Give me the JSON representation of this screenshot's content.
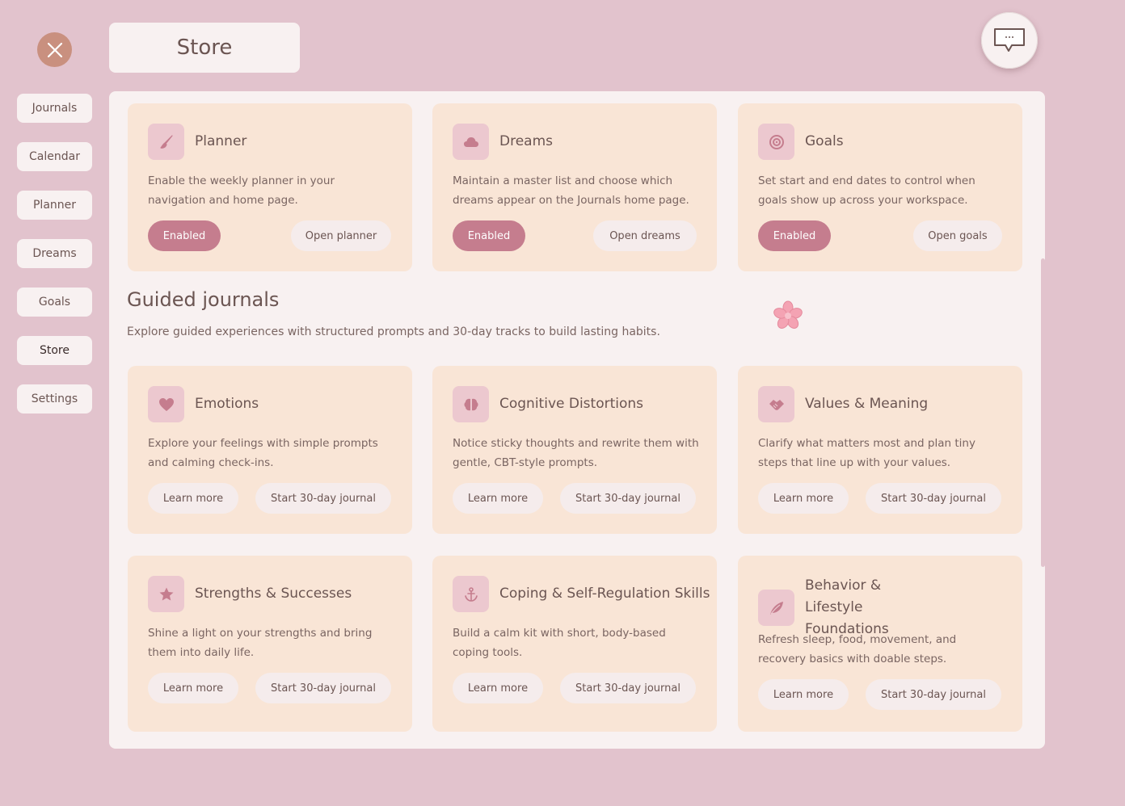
{
  "header": {
    "title": "Store"
  },
  "sidebar": {
    "items": [
      {
        "label": "Journals"
      },
      {
        "label": "Calendar"
      },
      {
        "label": "Planner"
      },
      {
        "label": "Dreams"
      },
      {
        "label": "Goals"
      },
      {
        "label": "Store",
        "active": true
      },
      {
        "label": "Settings"
      }
    ]
  },
  "features": [
    {
      "title": "Planner",
      "icon": "brush-icon",
      "desc": "Enable the weekly planner in your navigation and home page.",
      "status": "Enabled",
      "action": "Open planner"
    },
    {
      "title": "Dreams",
      "icon": "cloud-icon",
      "desc": "Maintain a master list and choose which dreams appear on the Journals home page.",
      "status": "Enabled",
      "action": "Open dreams"
    },
    {
      "title": "Goals",
      "icon": "target-icon",
      "desc": "Set start and end dates to control when goals show up across your workspace.",
      "status": "Enabled",
      "action": "Open goals"
    }
  ],
  "guided": {
    "title": "Guided journals",
    "subtitle": "Explore guided experiences with structured prompts and 30-day tracks to build lasting habits.",
    "learn_label": "Learn more",
    "start_label": "Start 30-day journal",
    "journals": [
      {
        "title": "Emotions",
        "icon": "heart-icon",
        "desc": "Explore your feelings with simple prompts and calming check-ins."
      },
      {
        "title": "Cognitive Distortions",
        "icon": "brain-icon",
        "desc": "Notice sticky thoughts and rewrite them with gentle, CBT-style prompts."
      },
      {
        "title": "Values & Meaning",
        "icon": "handshake-icon",
        "desc": "Clarify what matters most and plan tiny steps that line up with your values."
      },
      {
        "title": "Strengths & Successes",
        "icon": "star-icon",
        "desc": "Shine a light on your strengths and bring them into daily life."
      },
      {
        "title": "Coping & Self-Regulation Skills",
        "icon": "anchor-icon",
        "desc": "Build a calm kit with short, body-based coping tools."
      },
      {
        "title": "Behavior & Lifestyle Foundations",
        "icon": "leaf-icon",
        "desc": "Refresh sleep, food, movement, and recovery basics with doable steps."
      }
    ]
  },
  "colors": {
    "background": "#e2c3cd",
    "panel": "#f8f1f1",
    "card": "#f9e5d6",
    "accent": "#c57d8e",
    "close": "#c9907f"
  }
}
